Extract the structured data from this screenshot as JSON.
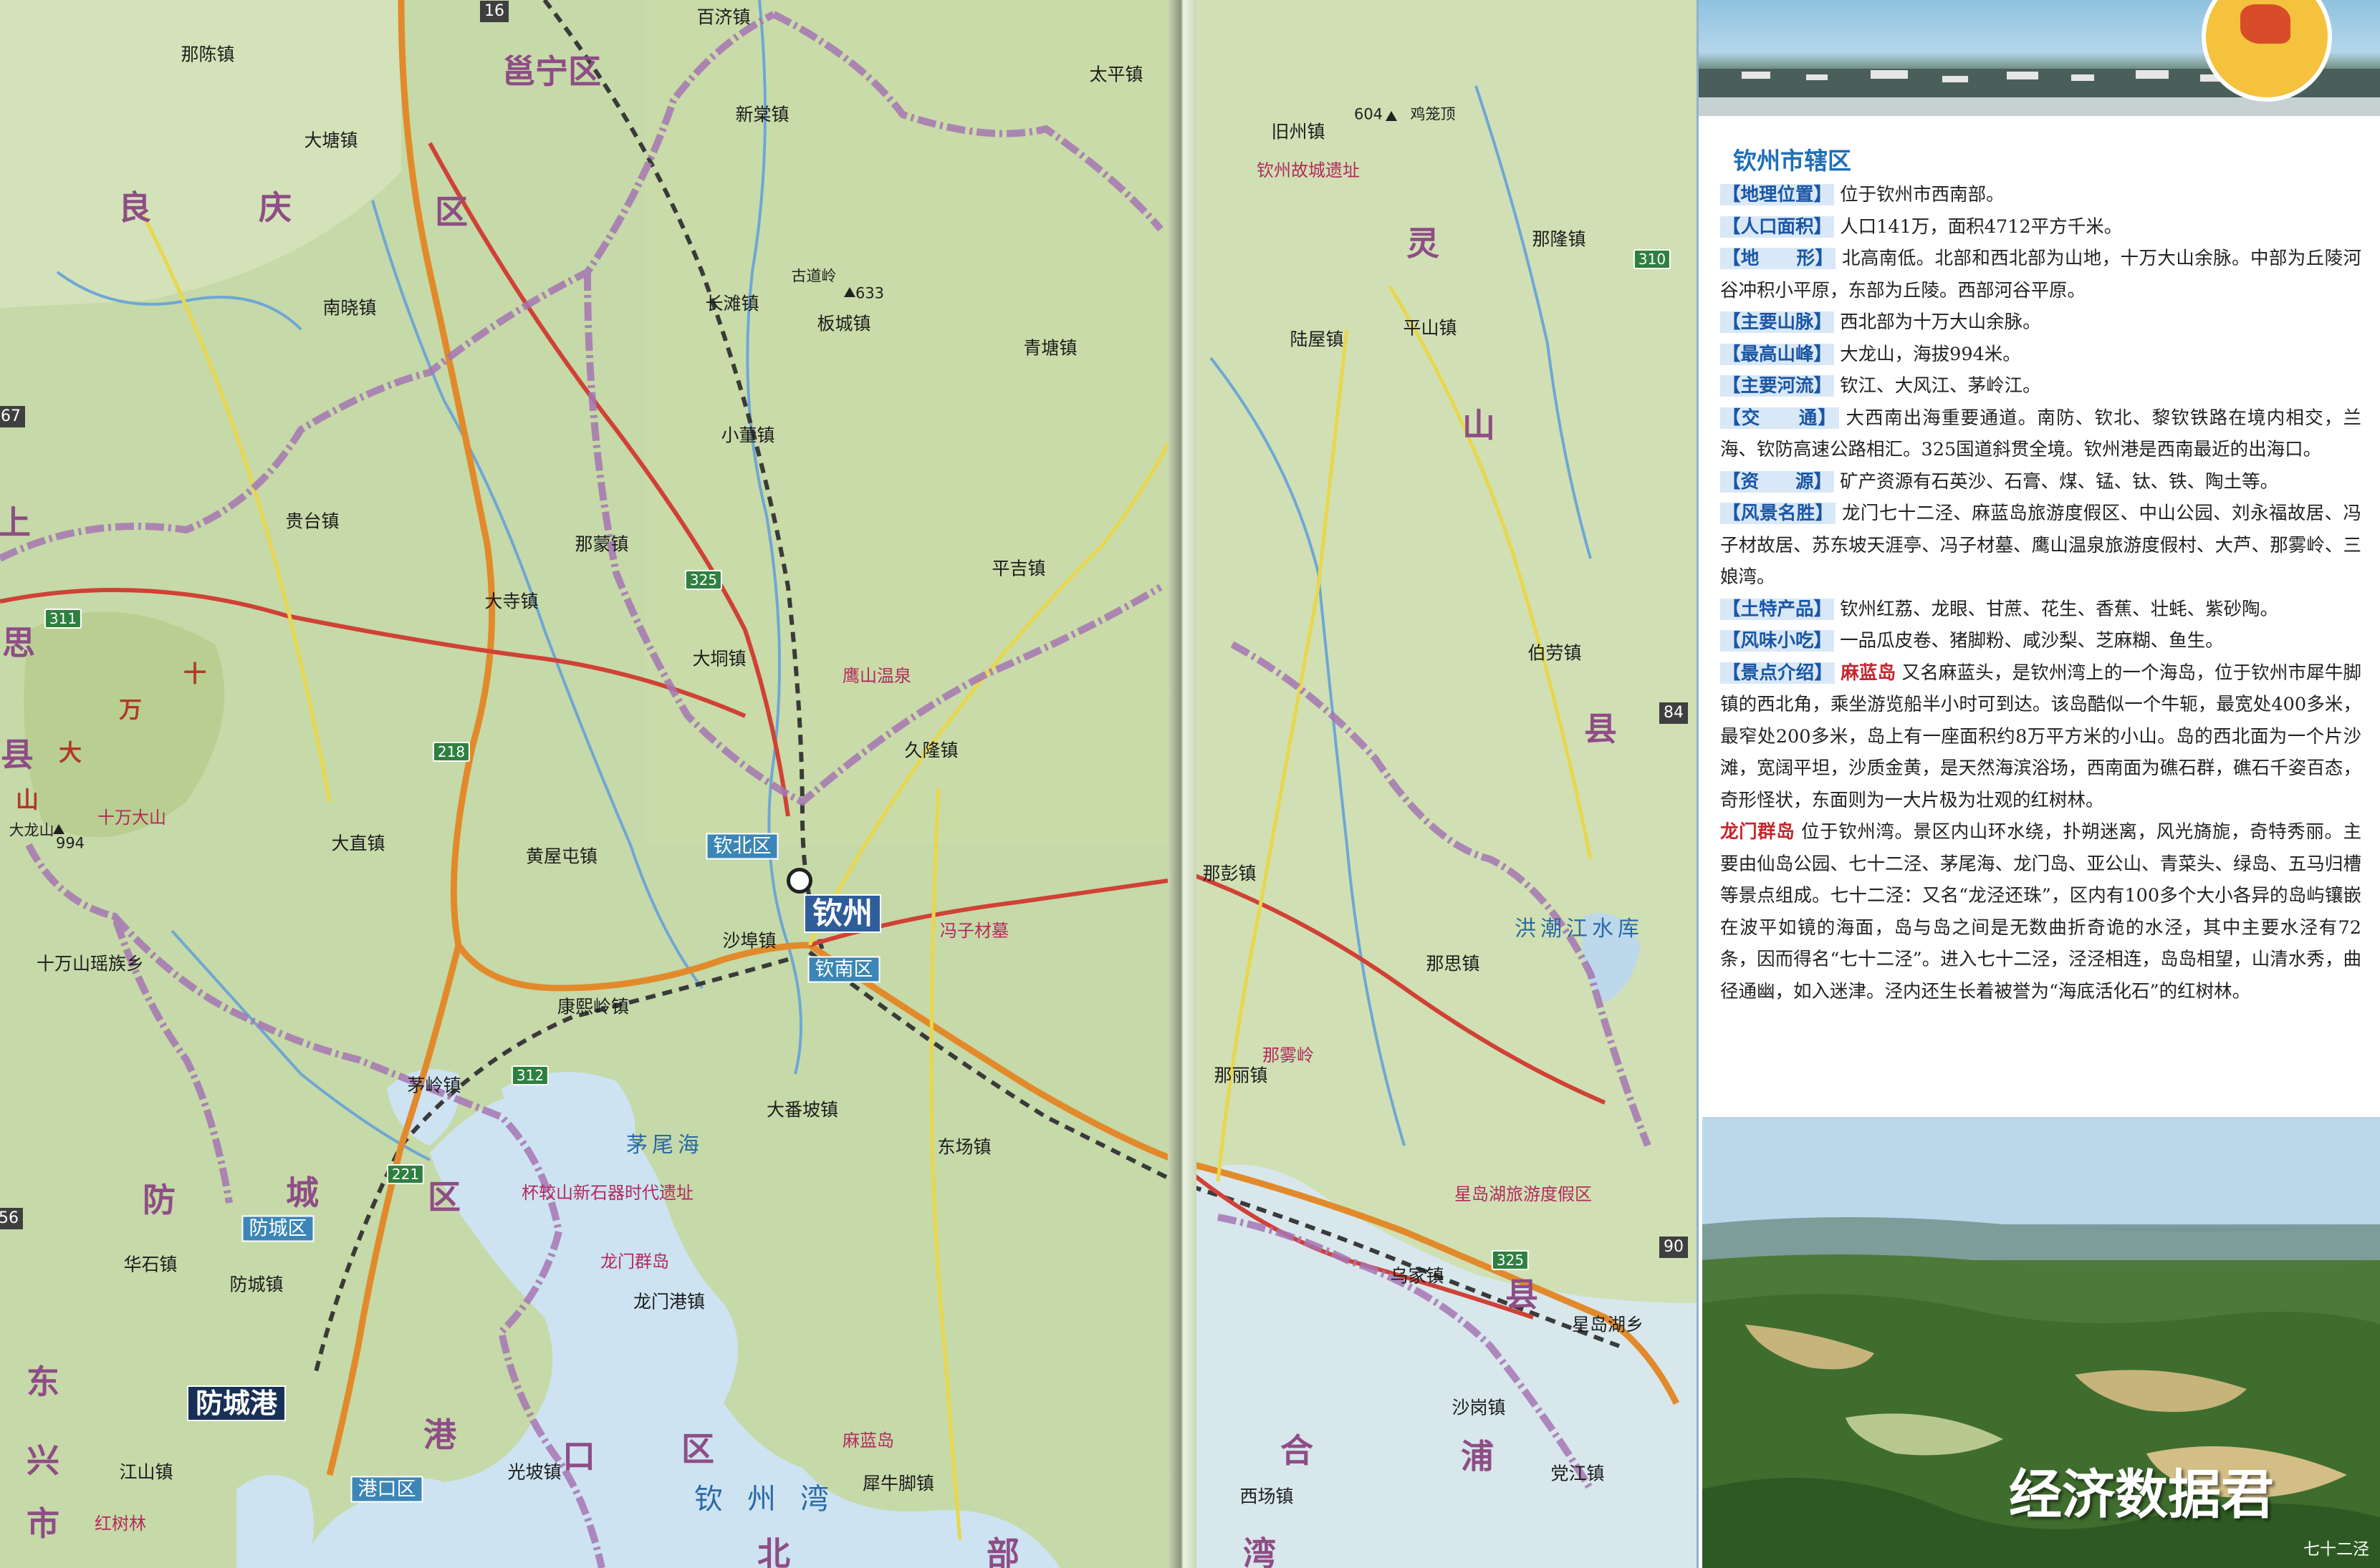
{
  "map": {
    "page_numbers": [
      "16",
      "67",
      "84",
      "90",
      "56"
    ],
    "road_numbers": [
      "311",
      "325",
      "218",
      "312",
      "221",
      "310"
    ],
    "districts": [
      "邕宁区",
      "良",
      "庆",
      "区",
      "上",
      "思",
      "县",
      "十",
      "万",
      "大",
      "山",
      "防",
      "城",
      "区",
      "东",
      "兴",
      "市",
      "港",
      "口",
      "区",
      "灵",
      "山",
      "县",
      "合",
      "浦",
      "县",
      "北",
      "部",
      "湾"
    ],
    "cities": {
      "qinzhou": "钦州",
      "fangchenggang": "防城港",
      "qinbei": "钦北区",
      "qinnan": "钦南区",
      "fangcheng": "防城区",
      "gangkou": "港口区"
    },
    "towns": [
      "那陈镇",
      "大塘镇",
      "南晓镇",
      "百济镇",
      "新棠镇",
      "太平镇",
      "长滩镇",
      "板城镇",
      "青塘镇",
      "小董镇",
      "那蒙镇",
      "平吉镇",
      "贵台镇",
      "大寺镇",
      "大垌镇",
      "久隆镇",
      "大直镇",
      "黄屋屯镇",
      "十万山瑶族乡",
      "沙埠镇",
      "康熙岭镇",
      "茅岭镇",
      "大番坡镇",
      "东场镇",
      "那丽镇",
      "那思镇",
      "华石镇",
      "防城镇",
      "龙门港镇",
      "江山镇",
      "光坡镇",
      "犀牛脚镇",
      "西场镇",
      "沙岗镇",
      "党江镇",
      "星岛湖乡",
      "乌家镇",
      "那彭镇",
      "伯劳镇",
      "陆屋镇",
      "旧州镇",
      "平山镇",
      "那隆镇"
    ],
    "water": [
      "钦州湾",
      "茅尾海",
      "洪潮江水库"
    ],
    "pois": [
      "大龙山",
      "十万大山",
      "古道岭",
      "鸡笼顶",
      "鹰山温泉",
      "冯子材墓",
      "那雾岭",
      "杯较山新石器时代遗址",
      "麻蓝岛",
      "龙门群岛",
      "星岛湖旅游度假区",
      "钦州故城遗址",
      "红树林"
    ],
    "peaks": [
      "994",
      "633",
      "604"
    ]
  },
  "panel": {
    "title": "钦州市辖区",
    "rows": [
      {
        "tag": "【地理位置】",
        "text": "位于钦州市西南部。"
      },
      {
        "tag": "【人口面积】",
        "text": "人口141万，面积4712平方千米。"
      },
      {
        "tag": "【地　　形】",
        "text": "北高南低。北部和西北部为山地，十万大山余脉。中部为丘陵河谷冲积小平原，东部为丘陵。西部河谷平原。"
      },
      {
        "tag": "【主要山脉】",
        "text": "西北部为十万大山余脉。"
      },
      {
        "tag": "【最高山峰】",
        "text": "大龙山，海拔994米。"
      },
      {
        "tag": "【主要河流】",
        "text": "钦江、大风江、茅岭江。"
      },
      {
        "tag": "【交　　通】",
        "text": "大西南出海重要通道。南防、钦北、黎钦铁路在境内相交，兰海、钦防高速公路相汇。325国道斜贯全境。钦州港是西南最近的出海口。"
      },
      {
        "tag": "【资　　源】",
        "text": "矿产资源有石英沙、石膏、煤、锰、钛、铁、陶土等。"
      },
      {
        "tag": "【风景名胜】",
        "text": "龙门七十二泾、麻蓝岛旅游度假区、中山公园、刘永福故居、冯子材故居、苏东坡天涯亭、冯子材墓、鹰山温泉旅游度假村、大芦、那雾岭、三娘湾。"
      },
      {
        "tag": "【土特产品】",
        "text": "钦州红荔、龙眼、甘蔗、花生、香蕉、壮蚝、紫砂陶。"
      },
      {
        "tag": "【风味小吃】",
        "text": "一品瓜皮卷、猪脚粉、咸沙梨、芝麻糊、鱼生。"
      }
    ],
    "spots_tag": "【景点介绍】",
    "spots": [
      {
        "name": "麻蓝岛",
        "text": "又名麻蓝头，是钦州湾上的一个海岛，位于钦州市犀牛脚镇的西北角，乘坐游览船半小时可到达。该岛酷似一个牛轭，最宽处400多米，最窄处200多米，岛上有一座面积约8万平方米的小山。岛的西北面为一个片沙滩，宽阔平坦，沙质金黄，是天然海滨浴场，西南面为礁石群，礁石千姿百态，奇形怪状，东面则为一大片极为壮观的红树林。"
      },
      {
        "name": "龙门群岛",
        "text": "位于钦州湾。景区内山环水绕，扑朔迷离，风光旖旎，奇特秀丽。主要由仙岛公园、七十二泾、茅尾海、龙门岛、亚公山、青菜头、绿岛、五马归槽等景点组成。七十二泾：又名“龙泾还珠”，区内有100多个大小各异的岛屿镶嵌在波平如镜的海面，岛与岛之间是无数曲折奇诡的水泾，其中主要水泾有72条，因而得名“七十二泾”。进入七十二泾，泾泾相连，岛岛相望，山清水秀，曲径通幽，如入迷津。泾内还生长着被誉为“海底活化石”的红树林。"
      }
    ],
    "watermark": "经济数据君",
    "photo_caption": "七十二泾"
  }
}
